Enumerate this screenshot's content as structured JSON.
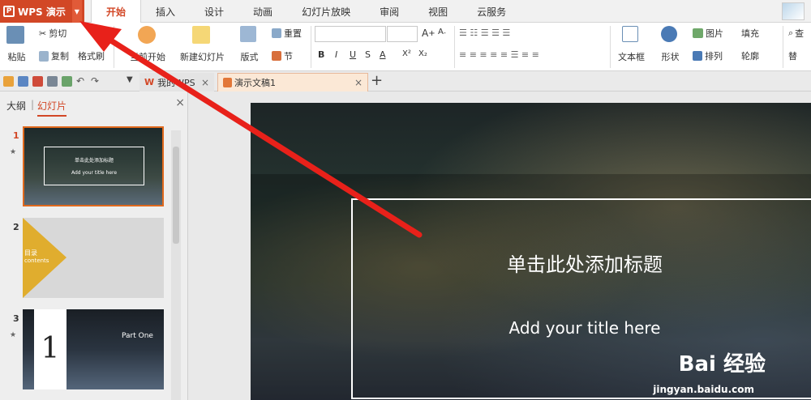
{
  "app": {
    "name": "WPS 演示",
    "logo": "P"
  },
  "menu": [
    "开始",
    "插入",
    "设计",
    "动画",
    "幻灯片放映",
    "审阅",
    "视图",
    "云服务"
  ],
  "ribbon": {
    "paste": "粘贴",
    "cut": "剪切",
    "copy": "复制",
    "format_painter": "格式刷",
    "from_current": "当前开始",
    "new_slide": "新建幻灯片",
    "layout": "版式",
    "reset": "重置",
    "section": "节",
    "font_bold": "B",
    "font_italic": "I",
    "font_underline": "U",
    "font_shadow": "S",
    "font_color": "A",
    "superscript": "X²",
    "subscript": "X₂",
    "textbox": "文本框",
    "shape": "形状",
    "picture": "图片",
    "fill": "填充",
    "arrange": "排列",
    "outline": "轮廓",
    "find": "查",
    "replace": "替"
  },
  "tabs": [
    {
      "label": "我的WPS",
      "close": "×"
    },
    {
      "label": "演示文稿1",
      "close": "×"
    }
  ],
  "panel": {
    "tab_outline": "大纲",
    "tab_slides": "幻灯片",
    "close": "×"
  },
  "slides": [
    {
      "num": "1",
      "mini_title": "单击此处添加标题",
      "mini_sub": "Add your title here"
    },
    {
      "num": "2",
      "mini_title": "目录",
      "mini_sub": "contents"
    },
    {
      "num": "3",
      "big_num": "1",
      "mini_title": "Part One"
    }
  ],
  "current_slide": {
    "title": "单击此处添加标题",
    "subtitle": "Add your title here"
  },
  "watermark": {
    "brand": "Bai 经验",
    "url": "jingyan.baidu.com"
  },
  "colors": {
    "accent": "#d24726",
    "arrow": "#e8211a"
  }
}
